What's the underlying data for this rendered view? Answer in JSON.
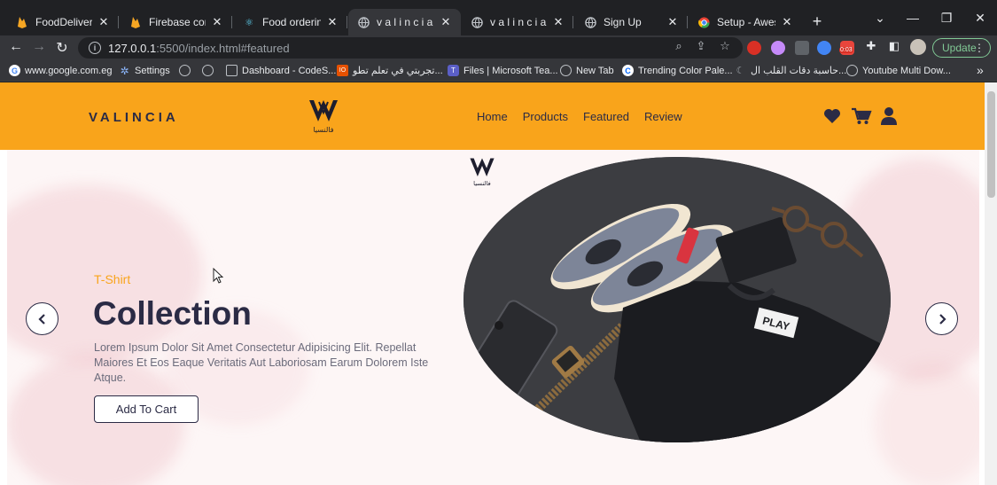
{
  "browser": {
    "tabs": [
      {
        "label": "FoodDelivery - St",
        "icon": "firebase-icon"
      },
      {
        "label": "Firebase console",
        "icon": "firebase-icon"
      },
      {
        "label": "Food ordering ap",
        "icon": "react-icon"
      },
      {
        "label": "v a l i n c i a",
        "icon": "globe-icon",
        "active": true
      },
      {
        "label": "v a l i n c i a",
        "icon": "globe-icon"
      },
      {
        "label": "Sign Up",
        "icon": "globe-icon"
      },
      {
        "label": "Setup - Awesome",
        "icon": "chrome-icon"
      }
    ],
    "new_tab": "+",
    "address": {
      "host": "127.0.0.1",
      "path": ":5500/index.html#featured"
    },
    "update_label": "Update",
    "badge": "0:03",
    "bookmarks": [
      {
        "label": "www.google.com.eg",
        "icon": "google-icon"
      },
      {
        "label": "Settings",
        "icon": "settings-icon"
      },
      {
        "label": "",
        "icon": "globe-icon"
      },
      {
        "label": "",
        "icon": "globe-icon"
      },
      {
        "label": "Dashboard - CodeS...",
        "icon": "page-icon"
      },
      {
        "label": "تجربتي في تعلم تطو...",
        "icon": "book-icon"
      },
      {
        "label": "Files | Microsoft Tea...",
        "icon": "teams-icon"
      },
      {
        "label": "New Tab",
        "icon": "globe-icon"
      },
      {
        "label": "Trending Color Pale...",
        "icon": "coolors-icon"
      },
      {
        "label": "حاسبة دقات القلب ال...",
        "icon": "heart-icon"
      },
      {
        "label": "Youtube Multi Dow...",
        "icon": "globe-icon"
      }
    ],
    "more_bookmarks": "»"
  },
  "site": {
    "brand": "VALINCIA",
    "logo_text": "فالنسيا",
    "nav": [
      "Home",
      "Products",
      "Featured",
      "Review"
    ],
    "header_icons": [
      "heart-icon",
      "cart-icon",
      "user-icon"
    ]
  },
  "hero": {
    "eyebrow": "T-Shirt",
    "headline": "Collection",
    "description": "Lorem Ipsum Dolor Sit Amet Consectetur Adipisicing Elit. Repellat Maiores Et Eos Eaque Veritatis Aut Laboriosam Earum Dolorem Iste Atque.",
    "cta": "Add To Cart",
    "shirt_label": "PLAY"
  },
  "colors": {
    "accent": "#f9a41b",
    "dark": "#2b2b45",
    "chrome_bg": "#202124"
  }
}
